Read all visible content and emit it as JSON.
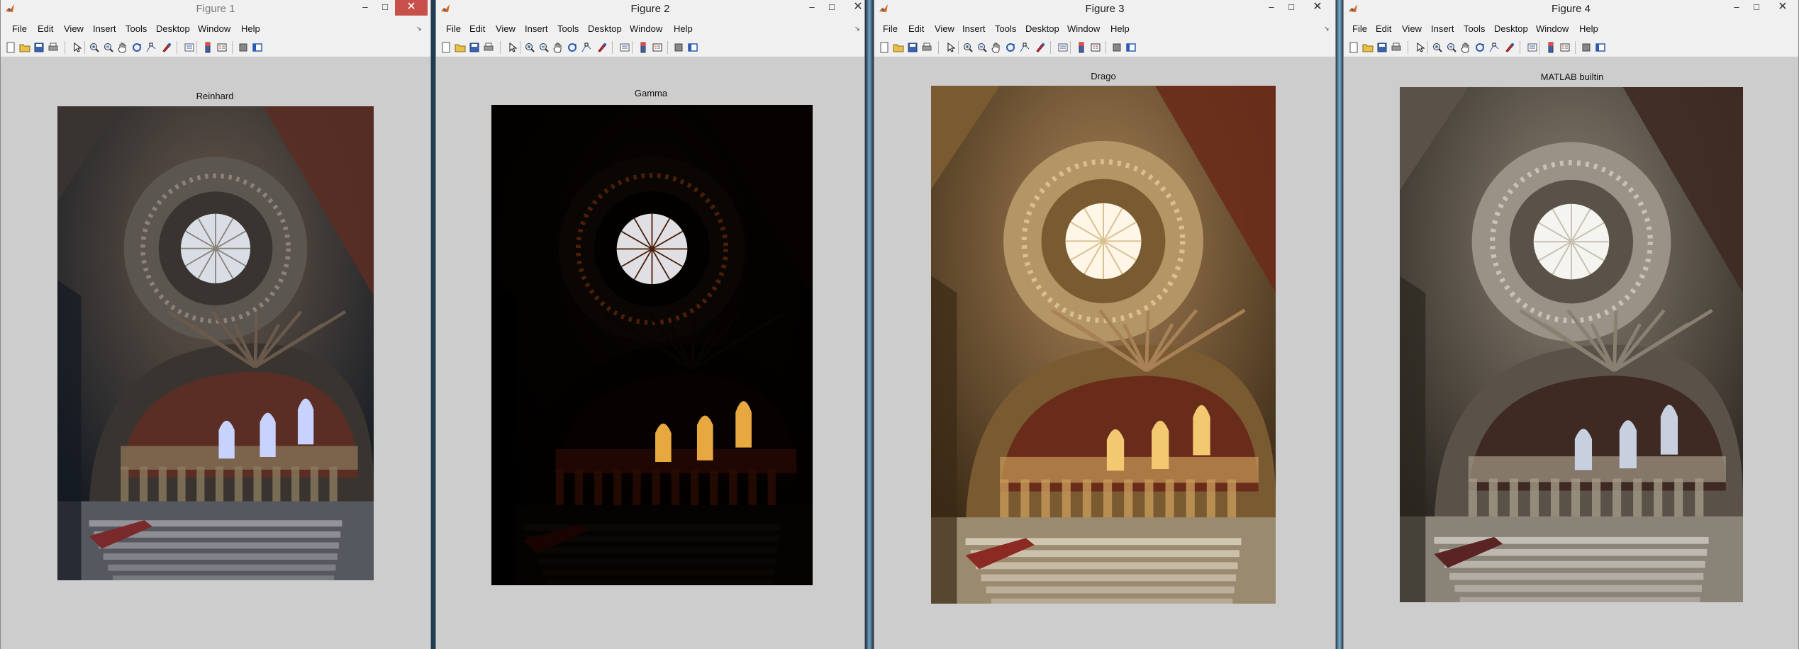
{
  "windows": [
    {
      "title": "Figure 1",
      "axes_title": "Reinhard",
      "active": true
    },
    {
      "title": "Figure 2",
      "axes_title": "Gamma",
      "active": false
    },
    {
      "title": "Figure 3",
      "axes_title": "Drago",
      "active": false
    },
    {
      "title": "Figure 4",
      "axes_title": "MATLAB builtin",
      "active": false
    }
  ],
  "menu": [
    "File",
    "Edit",
    "View",
    "Insert",
    "Tools",
    "Desktop",
    "Window",
    "Help"
  ],
  "controls": {
    "minimize": "–",
    "maximize": "□",
    "close": "✕"
  },
  "dock_arrow": "↘",
  "toolbar_icons": [
    "new-figure-icon",
    "open-file-icon",
    "save-icon",
    "print-icon",
    "edit-plot-icon",
    "zoom-in-icon",
    "zoom-out-icon",
    "pan-icon",
    "rotate-3d-icon",
    "data-cursor-icon",
    "brush-icon",
    "link-plot-icon",
    "colorbar-icon",
    "legend-icon",
    "hide-plot-tools-icon",
    "show-plot-tools-icon"
  ],
  "colors": {
    "titlebar": "#f0f0f0",
    "figure_bg": "#cdcdcd",
    "close_active": "#c7504a",
    "desktop": "#3a6d8c"
  }
}
